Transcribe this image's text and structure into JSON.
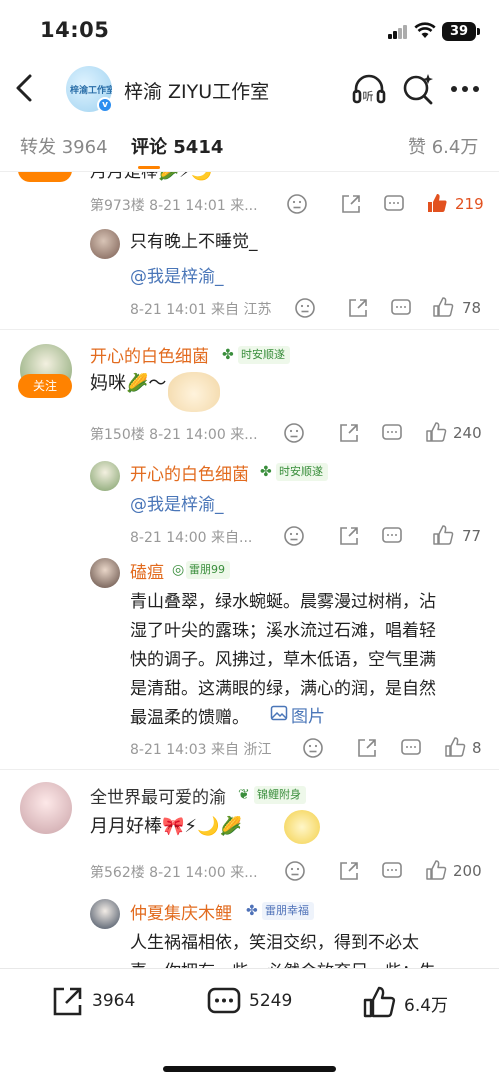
{
  "status_bar": {
    "time": "14:05",
    "battery": "39"
  },
  "header": {
    "title": "梓渝 ZIYU工作室",
    "avatar_text": "梓渝工作室"
  },
  "tabs": {
    "repost": "转发 3964",
    "comment": "评论 5414",
    "likes": "赞 6.4万"
  },
  "comments": [
    {
      "partial_text": "月月是棒🌽⚡🌙",
      "meta": "第973楼  8-21 14:01  来...",
      "likes": "219",
      "reply": {
        "text": "只有晚上不睡觉_",
        "mention": "@我是梓渝_",
        "meta": "8-21 14:01  来自 江苏",
        "likes": "78"
      }
    },
    {
      "name": "开心的白色细菌",
      "badge": "时安顺遂",
      "follow": "关注",
      "text": "妈咪🌽～",
      "meta": "第150楼  8-21 14:00  来...",
      "likes": "240",
      "replies": [
        {
          "name": "开心的白色细菌",
          "badge": "时安顺遂",
          "mention": "@我是梓渝_",
          "meta": "8-21 14:00  来自...",
          "likes": "77"
        },
        {
          "name": "磕瘟",
          "badge": "雷朋99",
          "lines": [
            "青山叠翠，绿水蜿蜒。晨雾漫过树梢，沾",
            "湿了叶尖的露珠；溪水流过石滩，唱着轻",
            "快的调子。风拂过，草木低语，空气里满",
            "是清甜。这满眼的绿，满心的润，是自然",
            "最温柔的馈赠。"
          ],
          "pic_link": "图片",
          "meta": "8-21 14:03  来自 浙江",
          "likes": "8"
        }
      ]
    },
    {
      "name": "全世界最可爱的渝",
      "badge": "锦鲤附身",
      "text": "月月好棒🎀⚡🌙🌽",
      "meta": "第562楼  8-21 14:00  来...",
      "likes": "200",
      "reply": {
        "name": "仲夏集庆木鲤",
        "badge": "雷朋幸福",
        "lines": [
          "人生祸福相依，笑泪交织，得到不必太",
          "喜，你拥有一些，必然会放弃另一些；失"
        ]
      }
    }
  ],
  "bottom_bar": {
    "repost": "3964",
    "comment": "5249",
    "like": "6.4万"
  }
}
